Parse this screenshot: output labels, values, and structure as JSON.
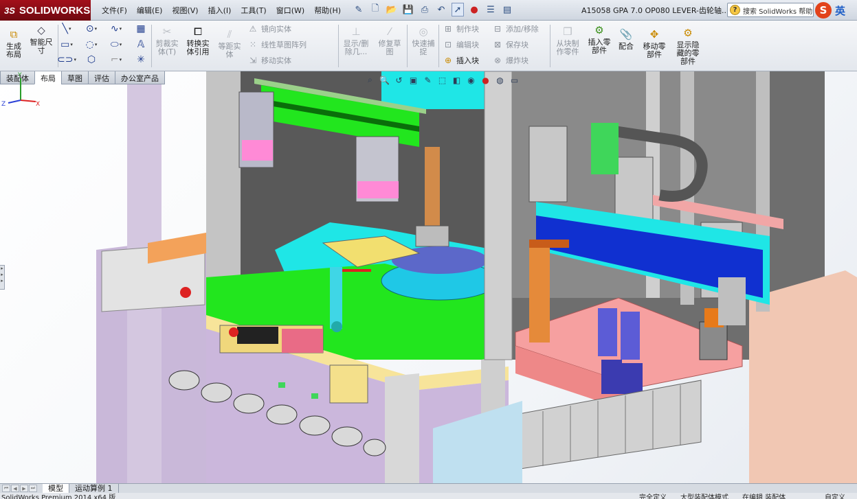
{
  "app": {
    "logo_prefix": "3S",
    "logo_text": "SOLIDWORKS",
    "document_title": "A15058 GPA 7.0 OP080 LEVER-齿轮轴...",
    "help_search_placeholder": "搜索 SolidWorks 帮助",
    "ime_label": "英"
  },
  "menu": [
    "文件(F)",
    "编辑(E)",
    "视图(V)",
    "插入(I)",
    "工具(T)",
    "窗口(W)",
    "帮助(H)"
  ],
  "toolbar": {
    "generate_layout": "生成\n布局",
    "smart_dimension": "智能尺\n寸",
    "trim_entities": "剪裁实\n体(T)",
    "convert_entities": "转换实\n体引用",
    "offset_entities": "等距实\n体",
    "mirror_entities": "镜向实体",
    "linear_pattern": "线性草图阵列",
    "move_entities": "移动实体",
    "show_hide_relations": "显示/删\n除几...",
    "repair_sketch": "修复草\n图",
    "quick_snaps": "快速捕\n捉",
    "make_block": "制作块",
    "edit_block": "编辑块",
    "insert_block": "插入块",
    "add_remove": "添加/移除",
    "save_block": "保存块",
    "explode_block": "爆炸块",
    "make_part_from_block": "从块制\n作零件",
    "insert_component": "插入零\n部件",
    "mate": "配合",
    "move_component": "移动零\n部件",
    "show_hidden_components": "显示隐\n藏的零\n部件"
  },
  "tabs": [
    "装配体",
    "布局",
    "草图",
    "评估",
    "办公室产品"
  ],
  "active_tab": "布局",
  "bottom_tabs": [
    "模型",
    "运动算例 1"
  ],
  "status": {
    "left": "SolidWorks Premium 2014 x64 版",
    "right_1": "完全定义",
    "right_2": "大型装配体模式",
    "right_3": "在编辑 装配体",
    "right_4": "自定义"
  },
  "triad": {
    "x": "X",
    "y": "Y",
    "z": "Z"
  },
  "colors": {
    "title_bg": "#d5dce6",
    "logo_red": "#8e0d16",
    "viewport_bg": "#ffffff",
    "frame_purple": "#c9b8d9",
    "deck_green": "#22e61e",
    "accent_cyan": "#1fe6e6",
    "plate_pink": "#f6a0a0",
    "rail_blue": "#1030d0"
  }
}
